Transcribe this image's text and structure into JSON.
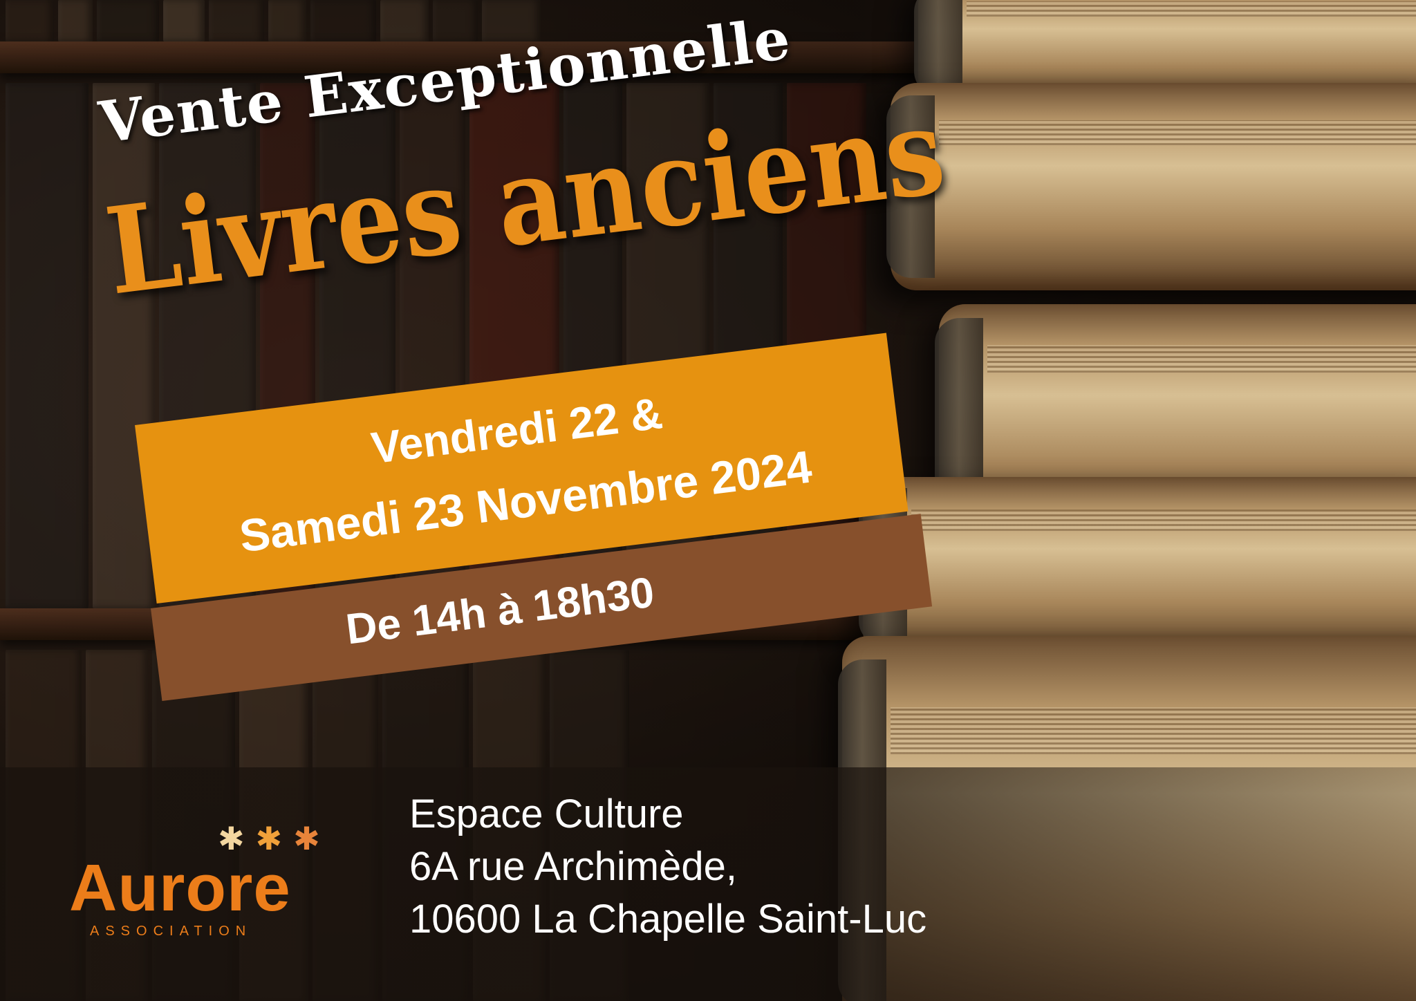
{
  "headline": {
    "line1": "Vente Exceptionnelle",
    "line2": "Livres anciens"
  },
  "dates": {
    "line1": "Vendredi 22 &",
    "line2": "Samedi 23 Novembre 2024",
    "hours": "De 14h à 18h30"
  },
  "logo": {
    "name": "Aurore",
    "subtitle": "ASSOCIATION",
    "stars_icon": "asterisk-stars-icon"
  },
  "address": {
    "venue": "Espace Culture",
    "street": "6A rue Archimède,",
    "city": "10600 La Chapelle Saint-Luc"
  },
  "colors": {
    "accent_orange": "#e69210",
    "brown_band": "#87502c",
    "title_orange": "#e98f1b",
    "logo_orange": "#ec7d1a",
    "text_white": "#ffffff"
  }
}
